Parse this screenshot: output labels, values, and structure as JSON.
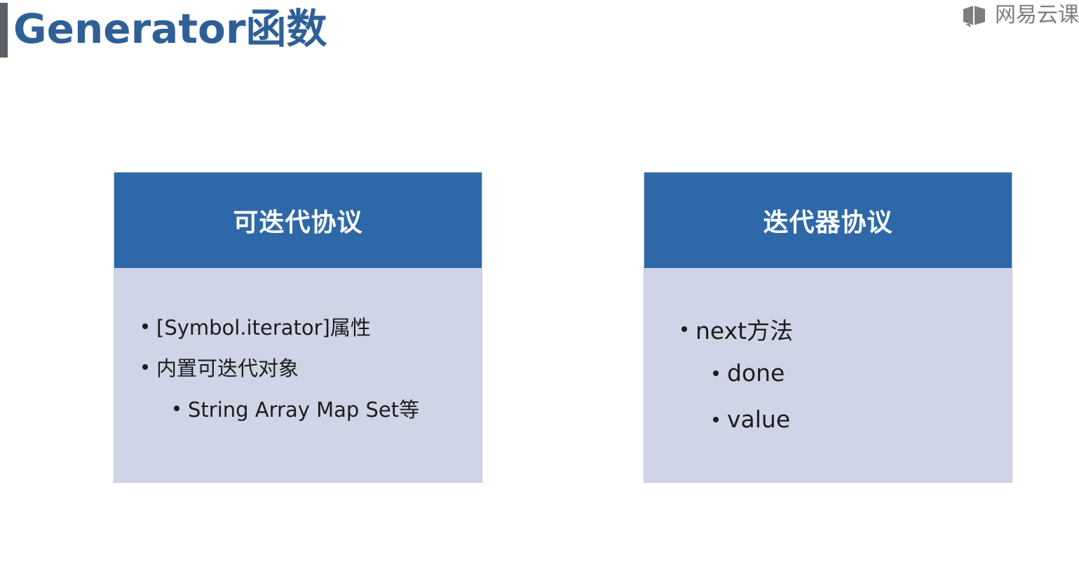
{
  "header": {
    "title": "Generator函数",
    "brand_text": "网易云课"
  },
  "cards": [
    {
      "title": "可迭代协议",
      "items": [
        {
          "text": "[Symbol.iterator]属性",
          "level": 1
        },
        {
          "text": "内置可迭代对象",
          "level": 1
        },
        {
          "text": "String Array Map Set等",
          "level": 2
        }
      ]
    },
    {
      "title": "迭代器协议",
      "items": [
        {
          "text": "next方法",
          "level": 1
        },
        {
          "text": "done",
          "level": 2
        },
        {
          "text": "value",
          "level": 2
        }
      ]
    }
  ],
  "colors": {
    "title": "#2f5f97",
    "card_header": "#2f68a8",
    "card_body": "#cfd4e6",
    "title_bar": "#5b5f66"
  },
  "icons": {
    "brand": "netease-cloud-classroom-logo-icon"
  }
}
